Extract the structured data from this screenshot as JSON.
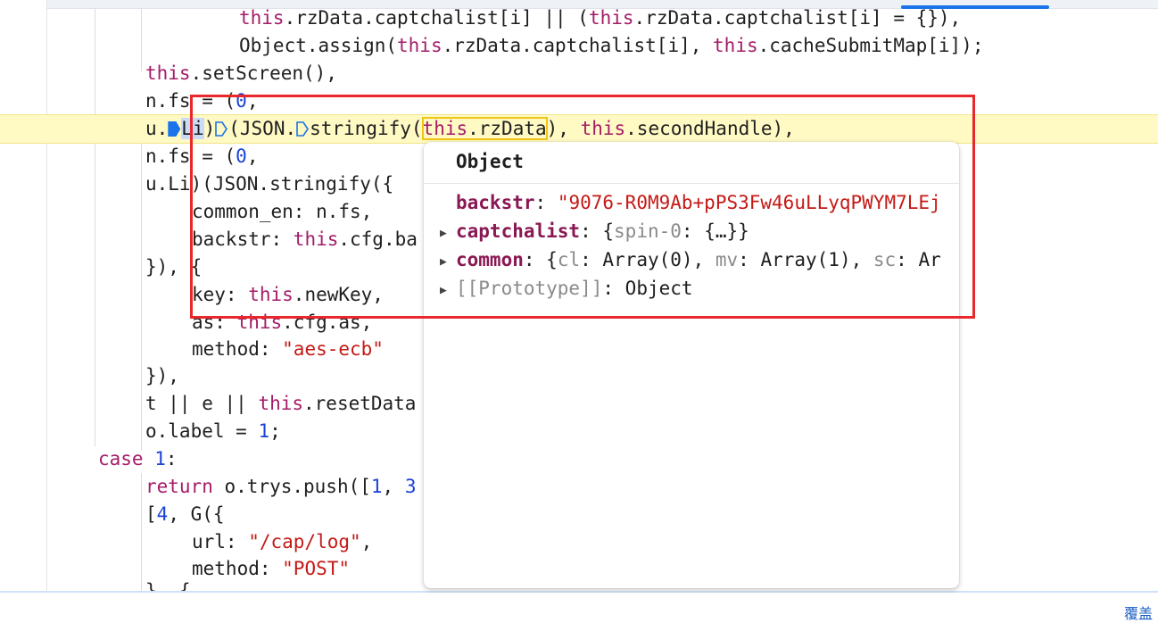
{
  "code": {
    "l1": {
      "a": "this",
      "b": ".rzData.captchalist[i] || (",
      "c": "this",
      "d": ".rzData.captchalist[i] = {}),"
    },
    "l2": {
      "a": "Object.assign(",
      "b": "this",
      "c": ".rzData.captchalist[i], ",
      "d": "this",
      "e": ".cacheSubmitMap[i]);"
    },
    "l3": {
      "a": "this",
      "b": ".setScreen(),"
    },
    "l4": {
      "a": "n.fs = (",
      "b": "0",
      ",": ","
    },
    "l5": {
      "a": "u.",
      "b": "Li",
      ")": ")",
      "d": "(JSON.",
      "e": "stringify(",
      "f": "this",
      "g": ".rzData",
      ")2": "), ",
      "h": "this",
      "i": ".secondHandle),"
    },
    "l6": {
      "a": "n.fs = (",
      "b": "0",
      ",": ","
    },
    "l7": {
      "a": "u.Li)(JSON.stringify({"
    },
    "l8": {
      "a": "common_en: n.fs,"
    },
    "l9": {
      "a": "backstr: ",
      "b": "this",
      "c": ".cfg.ba"
    },
    "l10": {
      "a": "}), {"
    },
    "l11": {
      "a": "key: ",
      "b": "this",
      "c": ".newKey,"
    },
    "l12": {
      "a": "as: ",
      "b": "this",
      "c": ".cfg.as,"
    },
    "l13": {
      "a": "method: ",
      "b": "\"aes-ecb\""
    },
    "l14": {
      "a": "}),"
    },
    "l15": {
      "a": "t || e || ",
      "b": "this",
      "c": ".resetData"
    },
    "l16": {
      "a": "o.label = ",
      "b": "1",
      ";": ";"
    },
    "l17": {
      "a": "case ",
      "b": "1",
      ":": ":"
    },
    "l18": {
      "a": "return ",
      "b": "o.trys.push([",
      "c": "1",
      ", ": ", ",
      "d": "3"
    },
    "l19": {
      "a": "[",
      "b": "4",
      ", G({": ", G({"
    },
    "l20": {
      "a": "url: ",
      "b": "\"/cap/log\"",
      ",": ","
    },
    "l21": {
      "a": "method: ",
      "b": "\"POST\""
    },
    "l22": {
      "a": "}, {"
    }
  },
  "popup": {
    "title": "Object",
    "rows": [
      {
        "key": "backstr",
        "sep": ": ",
        "value": "\"9076-R0M9Ab+pPS3Fw46uLLyqPWYM7LEj"
      },
      {
        "key": "captchalist",
        "sep": ": ",
        "v1": "{",
        "v2": "spin-0",
        ": ": ": ",
        "v3": "{…}}"
      },
      {
        "key": "common",
        "sep": ": ",
        "v1": "{",
        "k1": "cl",
        ": ": ": ",
        "v2": "Array(0), ",
        "k2": "mv",
        "v3": "Array(1), ",
        "k3": "sc",
        "v4": "Ar"
      },
      {
        "key": "[[Prototype]]",
        "sep": ": ",
        "value": "Object"
      }
    ]
  },
  "footer": {
    "text": "覆盖"
  },
  "colors": {
    "keyword": "#a51c68",
    "number": "#1a43d6",
    "string": "#c41a16",
    "highlight": "#fff9c4",
    "annotation": "#e8282a"
  }
}
